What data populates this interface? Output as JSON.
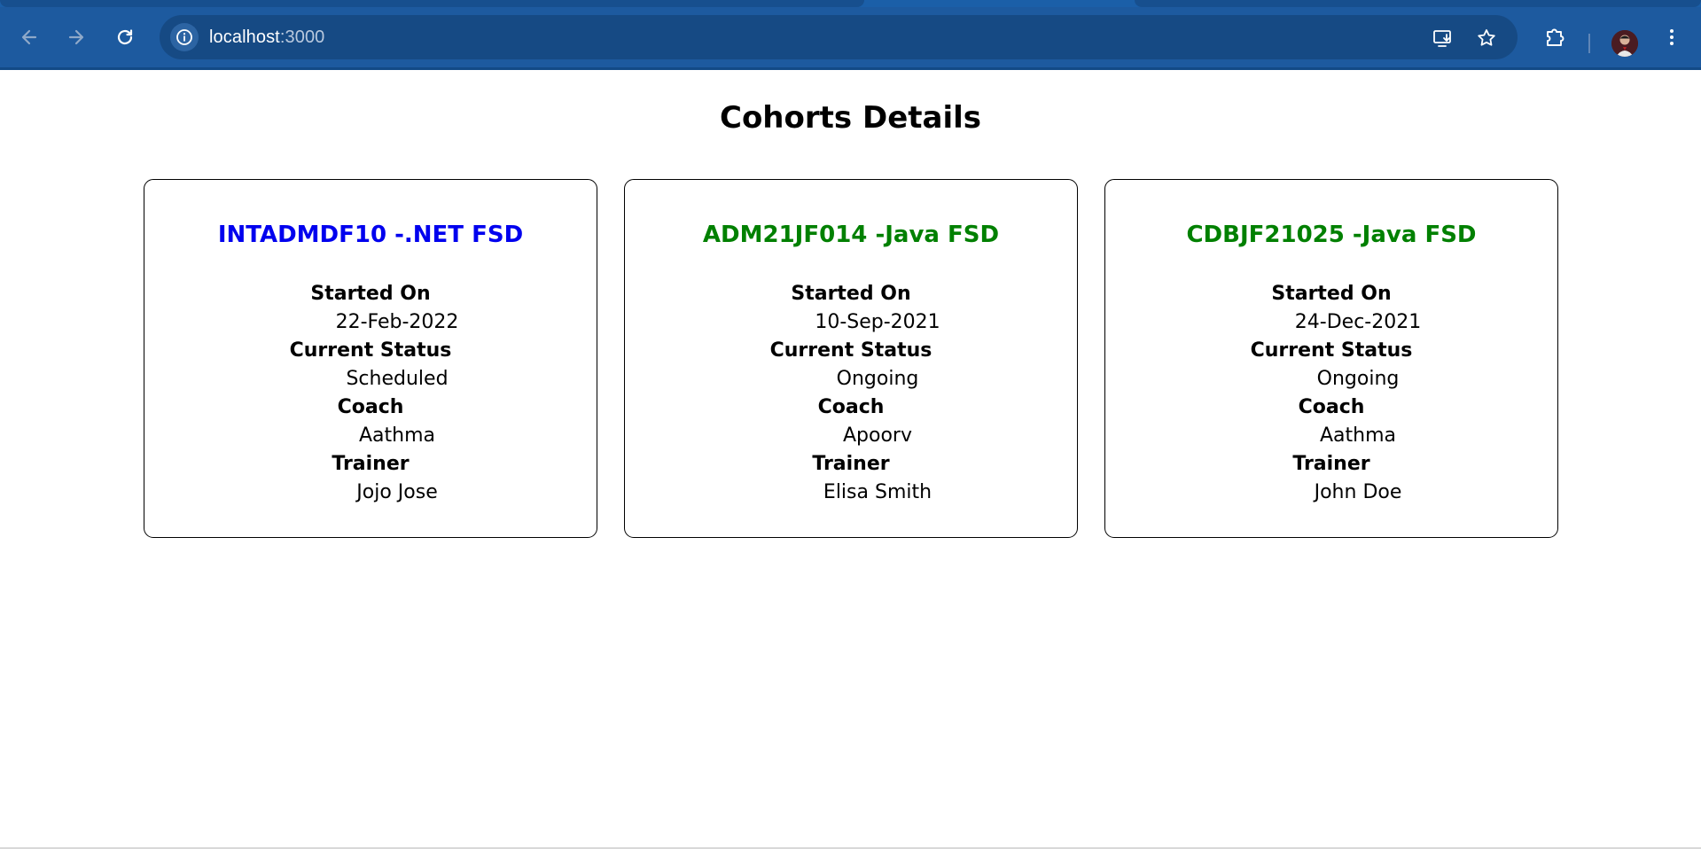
{
  "browser": {
    "url_host": "localhost",
    "url_port": ":3000"
  },
  "page": {
    "title": "Cohorts Details"
  },
  "labels": {
    "started_on": "Started On",
    "current_status": "Current Status",
    "coach": "Coach",
    "trainer": "Trainer"
  },
  "cohorts": [
    {
      "title": "INTADMDF10 -.NET FSD",
      "title_color": "#0000ee",
      "started_on": "22-Feb-2022",
      "current_status": "Scheduled",
      "coach": "Aathma",
      "trainer": "Jojo Jose"
    },
    {
      "title": "ADM21JF014 -Java FSD",
      "title_color": "#008000",
      "started_on": "10-Sep-2021",
      "current_status": "Ongoing",
      "coach": "Apoorv",
      "trainer": "Elisa Smith"
    },
    {
      "title": "CDBJF21025 -Java FSD",
      "title_color": "#008000",
      "started_on": "24-Dec-2021",
      "current_status": "Ongoing",
      "coach": "Aathma",
      "trainer": "John Doe"
    }
  ],
  "icons": {
    "back": "arrow-left-icon",
    "forward": "arrow-right-icon",
    "reload": "reload-icon",
    "site_info": "info-icon",
    "install": "install-app-icon",
    "bookmark": "star-icon",
    "extensions": "puzzle-icon",
    "profile": "avatar",
    "menu": "kebab-menu-icon"
  }
}
